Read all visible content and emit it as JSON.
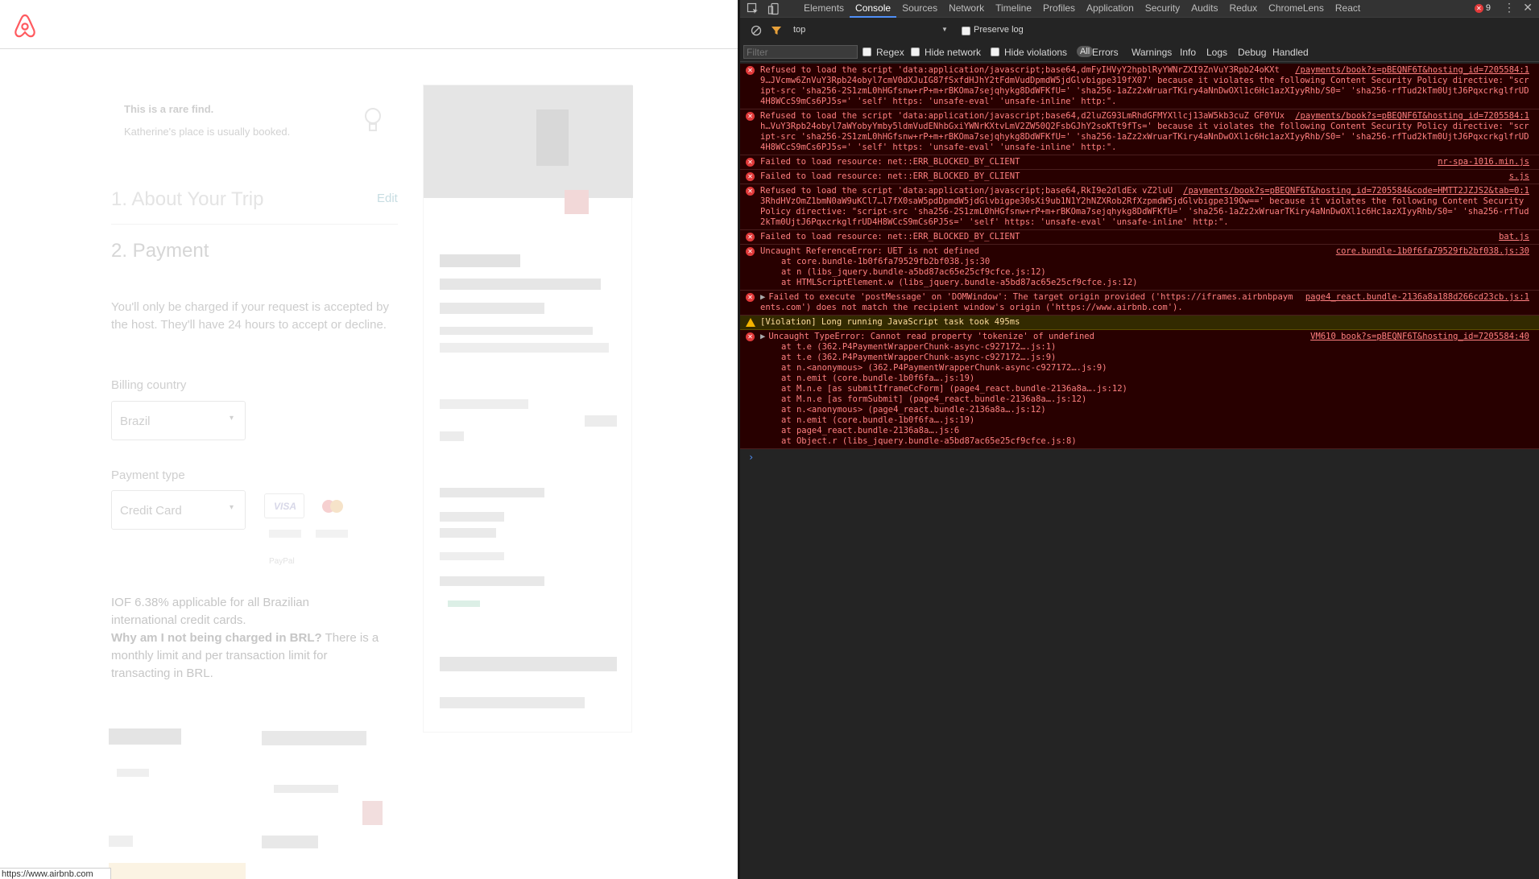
{
  "status_url": "https://www.airbnb.com",
  "page": {
    "rare_title": "This is a rare find.",
    "rare_text": "Katherine's place is usually booked.",
    "section1": "1. About Your Trip",
    "edit": "Edit",
    "section2": "2. Payment",
    "charge_text": "You'll only be charged if your request is accepted by the host. They'll have 24 hours to accept or decline.",
    "billing_label": "Billing country",
    "billing_value": "Brazil",
    "payment_label": "Payment type",
    "payment_value": "Credit Card",
    "iof_text": "IOF 6.38% applicable for all Brazilian international credit cards.",
    "why_bold": "Why am I not being charged in BRL?",
    "why_text": " There is a monthly limit and per transaction limit for transacting in BRL.",
    "visa_label": "VISA",
    "paypal_label": "PayPal"
  },
  "devtools": {
    "tabs": [
      "Elements",
      "Console",
      "Sources",
      "Network",
      "Timeline",
      "Profiles",
      "Application",
      "Security",
      "Audits",
      "Redux",
      "ChromeLens",
      "React"
    ],
    "active_tab": "Console",
    "error_count": "9",
    "context": "top",
    "preserve_log": "Preserve log",
    "filter_placeholder": "Filter",
    "regex": "Regex",
    "hide_network": "Hide network",
    "hide_violations": "Hide violations",
    "all": "All",
    "levels": [
      "Errors",
      "Warnings",
      "Info",
      "Logs",
      "Debug",
      "Handled"
    ]
  },
  "messages": [
    {
      "type": "err",
      "src": "/payments/book?s=pBEQNF6T&hosting_id=7205584:1",
      "text": "Refused to load the script 'data:application/javascript;base64,dmFyIHVyY2hpblRyYWNrZXI9ZnVuY3Rpb24oKXt9…JVcmw6ZnVuY3Rpb24obyl7cmV0dXJuIG87fSxfdHJhY2tFdmVudDpmdW5jdGlvbigpe319fX07' because it violates the following Content Security Policy directive: \"script-src 'sha256-2S1zmL0hHGfsnw+rP+m+rBKOma7sejqhykg8DdWFKfU=' 'sha256-1aZz2xWruarTKiry4aNnDwOXl1c6Hc1azXIyyRhb/S0=' 'sha256-rfTud2kTm0UjtJ6PqxcrkglfrUD4H8WCcS9mCs6PJ5s=' 'self' https: 'unsafe-eval' 'unsafe-inline' http:\"."
    },
    {
      "type": "err",
      "src": "/payments/book?s=pBEQNF6T&hosting_id=7205584:1",
      "text": "Refused to load the script 'data:application/javascript;base64,d2luZG93LmRhdGFMYXllcj13aW5kb3cuZ GF0YUxh…VuY3Rpb24obyl7aWYobyYmby5ldmVudENhbGxiYWNrKXtvLmV2ZW50Q2FsbGJhY2soKTt9fTs=' because it violates the following Content Security Policy directive: \"script-src 'sha256-2S1zmL0hHGfsnw+rP+m+rBKOma7sejqhykg8DdWFKfU=' 'sha256-1aZz2xWruarTKiry4aNnDwOXl1c6Hc1azXIyyRhb/S0=' 'sha256-rfTud2kTm0UjtJ6PqxcrkglfrUD4H8WCcS9mCs6PJ5s=' 'self' https: 'unsafe-eval' 'unsafe-inline' http:\"."
    },
    {
      "type": "err",
      "src": "nr-spa-1016.min.js",
      "text": "Failed to load resource: net::ERR_BLOCKED_BY_CLIENT"
    },
    {
      "type": "err",
      "src": "s.js",
      "text": "Failed to load resource: net::ERR_BLOCKED_BY_CLIENT"
    },
    {
      "type": "err",
      "src": "/payments/book?s=pBEQNF6T&hosting_id=7205584&code=HMTT2JZJS2&tab=0:1",
      "text": "Refused to load the script 'data:application/javascript;base64,RkI9e2dldEx vZ2luU3RhdHVzOmZ1bmN0aW9uKCl7…l7fX0saW5pdDpmdW5jdGlvbigpe30sXi9ub1N1Y2hNZXRob2RfXzpmdW5jdGlvbigpe319Ow==' because it violates the following Content Security Policy directive: \"script-src 'sha256-2S1zmL0hHGfsnw+rP+m+rBKOma7sejqhykg8DdWFKfU=' 'sha256-1aZz2xWruarTKiry4aNnDwOXl1c6Hc1azXIyyRhb/S0=' 'sha256-rfTud2kTm0UjtJ6PqxcrkglfrUD4H8WCcS9mCs6PJ5s=' 'self' https: 'unsafe-eval' 'unsafe-inline' http:\"."
    },
    {
      "type": "err",
      "src": "bat.js",
      "text": "Failed to load resource: net::ERR_BLOCKED_BY_CLIENT"
    },
    {
      "type": "err",
      "src": "core.bundle-1b0f6fa79529fb2bf038.js:30",
      "text": "Uncaught ReferenceError: UET is not defined",
      "stack": [
        "at core.bundle-1b0f6fa79529fb2bf038.js:30",
        "at n (libs_jquery.bundle-a5bd87ac65e25cf9cfce.js:12)",
        "at HTMLScriptElement.w (libs_jquery.bundle-a5bd87ac65e25cf9cfce.js:12)"
      ]
    },
    {
      "type": "err",
      "tri": true,
      "src": "page4_react.bundle-2136a8a188d266cd23cb.js:1",
      "text": "Failed to execute 'postMessage' on 'DOMWindow': The target origin provided ('https://iframes.airbnbpayments.com') does not match the recipient window's origin ('https://www.airbnb.com')."
    },
    {
      "type": "warn",
      "src": "",
      "text": "[Violation] Long running JavaScript task took 495ms"
    },
    {
      "type": "err",
      "tri": true,
      "src": "VM610 book?s=pBEQNF6T&hosting_id=7205584:40",
      "text": "Uncaught TypeError: Cannot read property 'tokenize' of undefined",
      "stack": [
        "at t.e (362.P4PaymentWrapperChunk-async-c927172….js:1)",
        "at t.e (362.P4PaymentWrapperChunk-async-c927172….js:9)",
        "at n.<anonymous> (362.P4PaymentWrapperChunk-async-c927172….js:9)",
        "at n.emit (core.bundle-1b0f6fa….js:19)",
        "at M.n.e [as submitIframeCcForm] (page4_react.bundle-2136a8a….js:12)",
        "at M.n.e [as formSubmit] (page4_react.bundle-2136a8a….js:12)",
        "at n.<anonymous> (page4_react.bundle-2136a8a….js:12)",
        "at n.emit (core.bundle-1b0f6fa….js:19)",
        "at page4_react.bundle-2136a8a….js:6",
        "at Object.r (libs_jquery.bundle-a5bd87ac65e25cf9cfce.js:8)"
      ]
    }
  ]
}
